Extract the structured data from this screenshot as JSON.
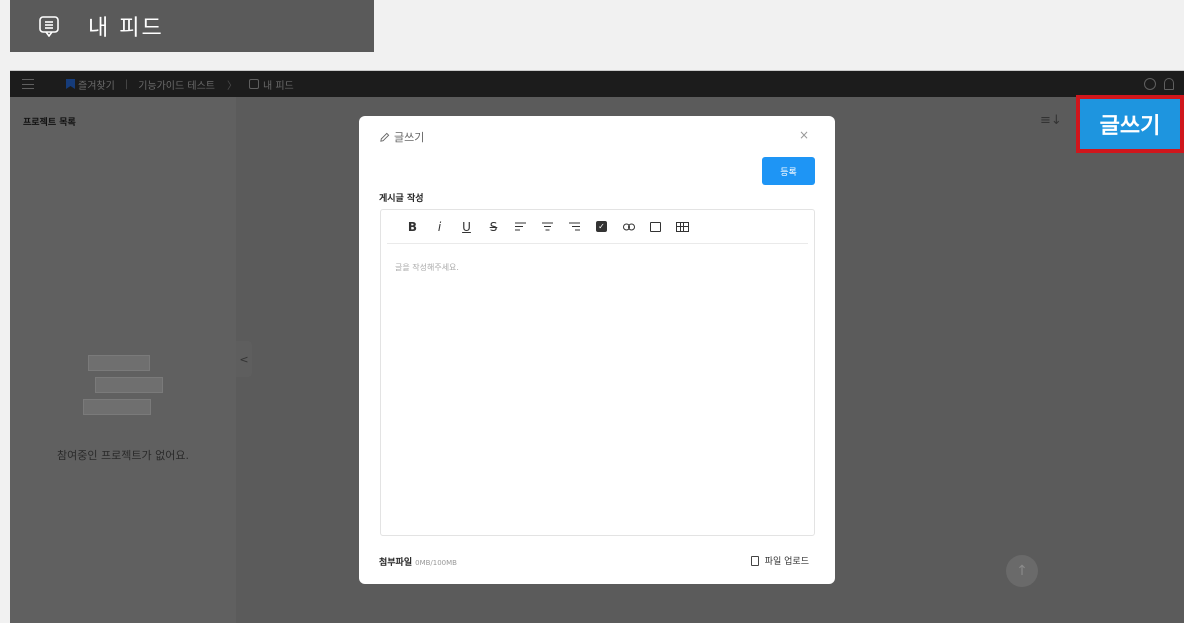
{
  "caption": {
    "title": "내 피드"
  },
  "topbar": {
    "favorites": "즐겨찾기",
    "separator": "|",
    "project": "기능가이드 테스트",
    "chevron": "〉",
    "page": "내 피드"
  },
  "sidebar": {
    "title": "프로젝트 목록",
    "empty_text": "참여중인 프로젝트가 없어요.",
    "collapse": "<"
  },
  "callout": {
    "label": "글쓰기"
  },
  "modal": {
    "title": "글쓰기",
    "close": "×",
    "submit": "등록",
    "section_label": "게시글 작성",
    "toolbar": [
      "B",
      "i",
      "U",
      "S"
    ],
    "placeholder": "글을 작성해주세요.",
    "attach_label": "첨부파일",
    "attach_size": "0MB/100MB",
    "upload": "파일 업로드"
  },
  "scroll_top": "↑",
  "sort_icon": "≡↓",
  "colors": {
    "accent": "#1e95f5",
    "callout_border": "#d0161c",
    "callout_bg": "#1e95df"
  }
}
